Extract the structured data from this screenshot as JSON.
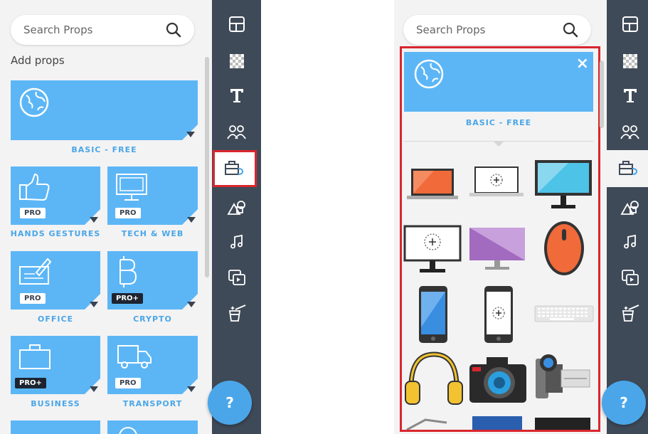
{
  "left": {
    "search": {
      "placeholder": "Search Props"
    },
    "add_props_label": "Add props",
    "basic": {
      "label": "BASIC - FREE"
    },
    "categories": [
      {
        "label": "HANDS GESTURES",
        "badge": "PRO"
      },
      {
        "label": "TECH & WEB",
        "badge": "PRO"
      },
      {
        "label": "OFFICE",
        "badge": "PRO"
      },
      {
        "label": "CRYPTO",
        "badge": "PRO+"
      },
      {
        "label": "BUSINESS",
        "badge": "PRO+"
      },
      {
        "label": "TRANSPORT",
        "badge": "PRO"
      }
    ],
    "help_label": "?"
  },
  "right": {
    "search": {
      "placeholder": "Search Props"
    },
    "basic": {
      "label": "BASIC - FREE"
    },
    "close_label": "×",
    "help_label": "?"
  },
  "sidebar_icons": [
    "layout-icon",
    "texture-icon",
    "text-icon",
    "characters-icon",
    "props-icon",
    "shapes-icon",
    "music-icon",
    "media-icon",
    "magic-icon"
  ],
  "colors": {
    "accent": "#5cb6f6",
    "sidebar": "#3f4a58",
    "highlight": "#d9262e"
  }
}
